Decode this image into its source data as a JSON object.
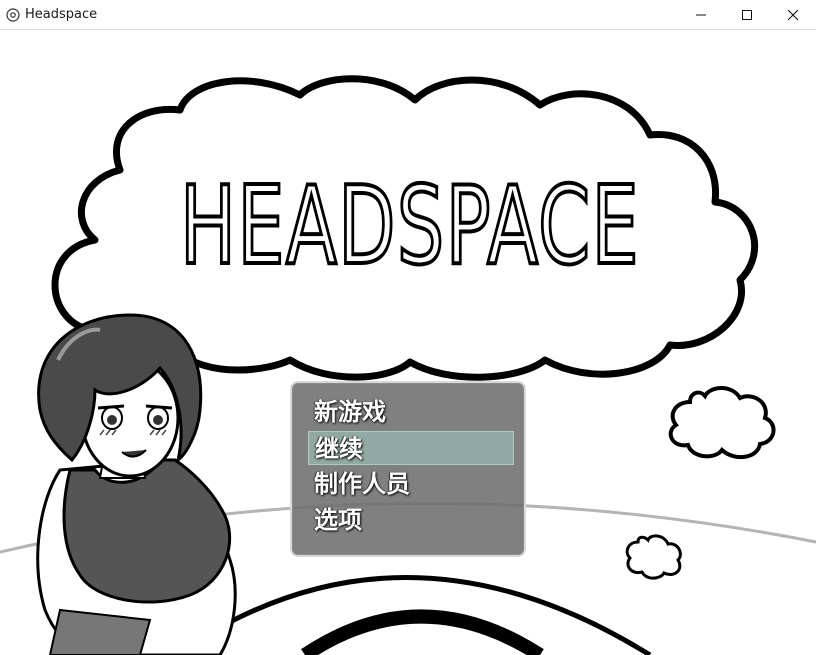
{
  "window": {
    "title": "Headspace",
    "minimize_icon": "minimize-icon",
    "maximize_icon": "maximize-icon",
    "close_icon": "close-icon"
  },
  "game": {
    "logo_text": "HEADSPACE",
    "menu": {
      "items": [
        {
          "label": "新游戏",
          "selected": false
        },
        {
          "label": "继续",
          "selected": true
        },
        {
          "label": "制作人员",
          "selected": false
        },
        {
          "label": "选项",
          "selected": false
        }
      ]
    }
  },
  "colors": {
    "menu_bg": "#6e6e6e",
    "menu_highlight": "#a0c8be",
    "line_art": "#000000"
  }
}
